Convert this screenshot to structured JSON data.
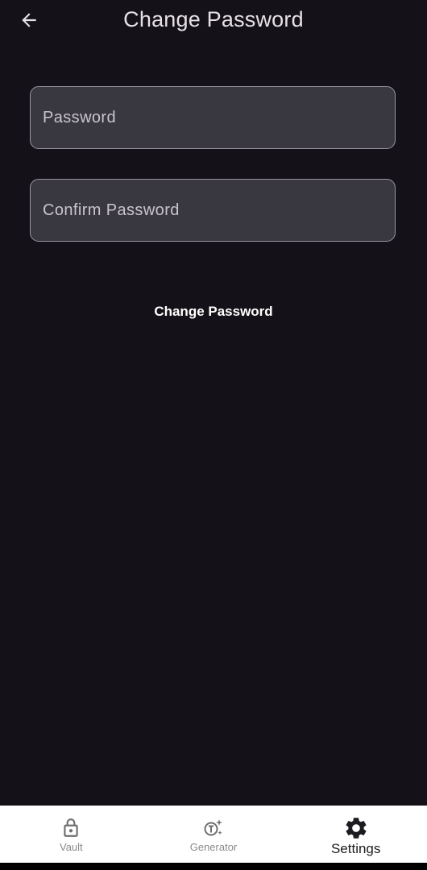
{
  "header": {
    "title": "Change Password",
    "back_icon": "arrow-left-icon"
  },
  "form": {
    "password": {
      "placeholder": "Password",
      "value": ""
    },
    "confirm_password": {
      "placeholder": "Confirm Password",
      "value": ""
    },
    "submit_label": "Change Password"
  },
  "bottom_nav": {
    "items": [
      {
        "label": "Vault",
        "icon": "lock-icon",
        "active": false
      },
      {
        "label": "Generator",
        "icon": "generator-icon",
        "active": false
      },
      {
        "label": "Settings",
        "icon": "gear-icon",
        "active": true
      }
    ]
  },
  "colors": {
    "background": "#141218",
    "field_fill": "#39373f",
    "field_border": "#9a96a0",
    "text_primary": "#e6e1e5",
    "nav_background": "#ffffff",
    "nav_inactive": "#8a8a8a",
    "nav_active": "#1c1b1f"
  }
}
